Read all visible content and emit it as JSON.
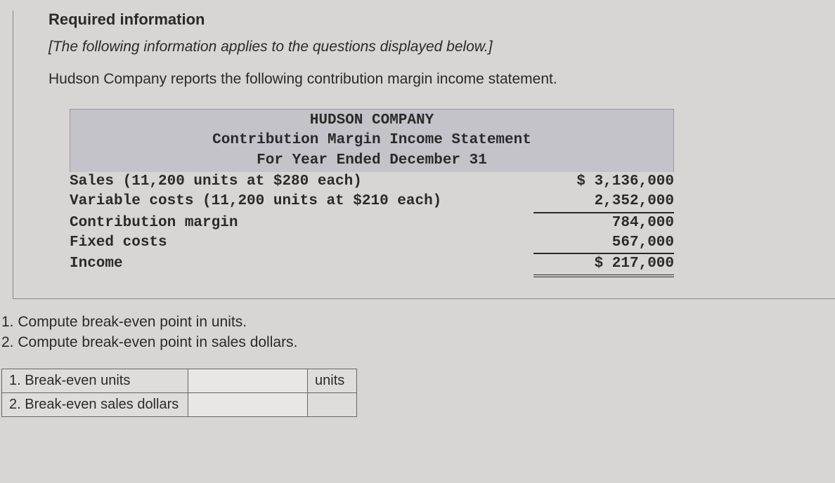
{
  "header": {
    "required": "Required information",
    "note": "[The following information applies to the questions displayed below.]",
    "intro": "Hudson Company reports the following contribution margin income statement."
  },
  "statement": {
    "title_line1": "HUDSON COMPANY",
    "title_line2": "Contribution Margin Income Statement",
    "title_line3": "For Year Ended December 31",
    "rows": [
      {
        "label": "Sales (11,200 units at $280 each)",
        "value": "$ 3,136,000"
      },
      {
        "label": "Variable costs (11,200 units at $210 each)",
        "value": "2,352,000"
      },
      {
        "label": "Contribution margin",
        "value": "784,000"
      },
      {
        "label": "Fixed costs",
        "value": "567,000"
      },
      {
        "label": "Income",
        "value": "$ 217,000"
      }
    ]
  },
  "questions": {
    "q1": "1. Compute break-even point in units.",
    "q2": "2. Compute break-even point in sales dollars."
  },
  "answers": {
    "row1_label": "1. Break-even units",
    "row1_value": "",
    "row1_unit": "units",
    "row2_label": "2. Break-even sales dollars",
    "row2_value": "",
    "row2_unit": ""
  }
}
